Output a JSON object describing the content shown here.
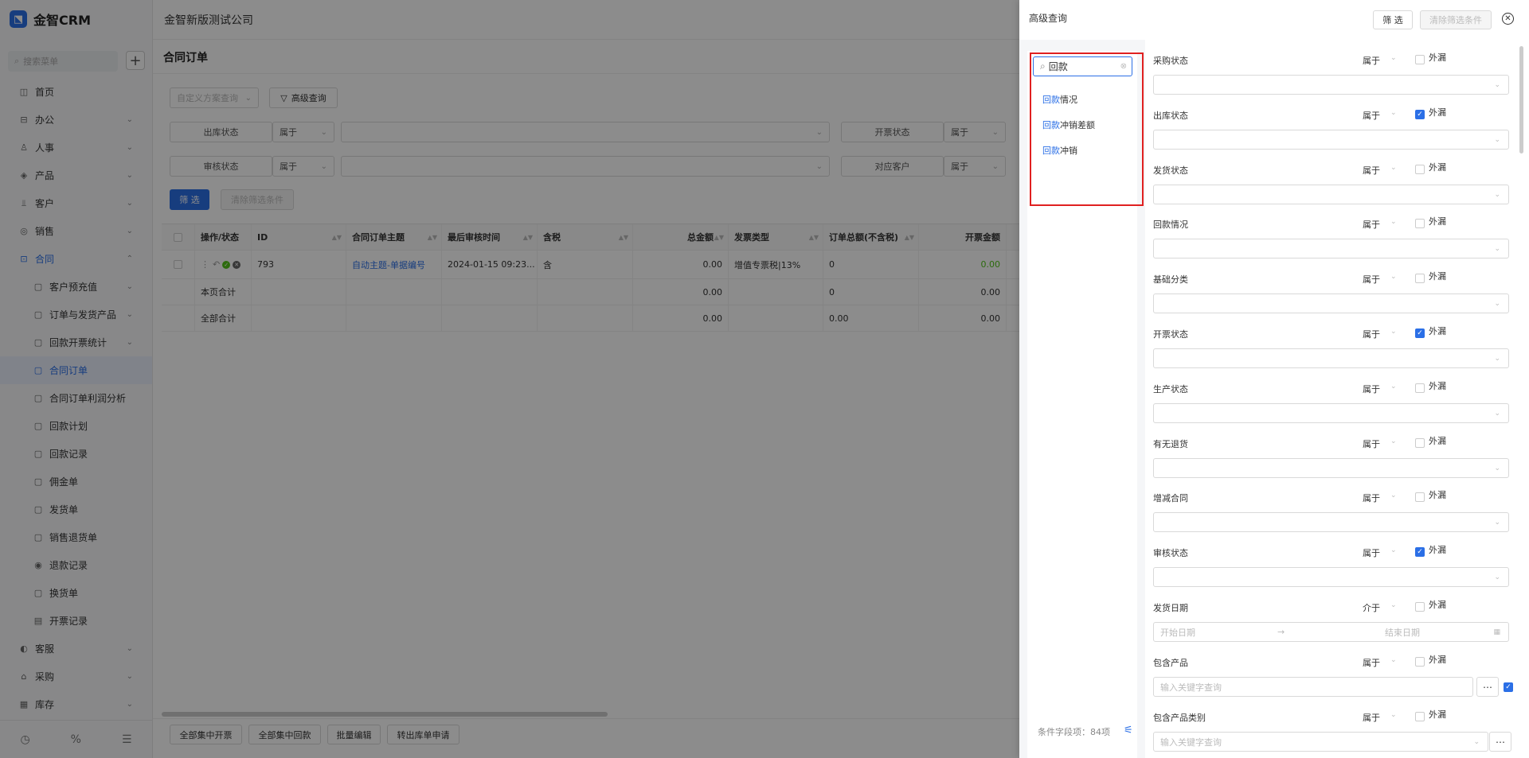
{
  "app": {
    "name": "金智CRM",
    "company": "金智新版测试公司"
  },
  "sidebar": {
    "search_placeholder": "搜索菜单",
    "items": [
      {
        "label": "首页",
        "icon": "home-icon"
      },
      {
        "label": "办公",
        "icon": "office-icon"
      },
      {
        "label": "人事",
        "icon": "people-icon"
      },
      {
        "label": "产品",
        "icon": "product-icon"
      },
      {
        "label": "客户",
        "icon": "customer-icon"
      },
      {
        "label": "销售",
        "icon": "sales-icon"
      },
      {
        "label": "合同",
        "icon": "contract-icon"
      },
      {
        "label": "客户预充值",
        "icon": "file-icon"
      },
      {
        "label": "订单与发货产品",
        "icon": "file-icon"
      },
      {
        "label": "回款开票统计",
        "icon": "file-icon"
      },
      {
        "label": "合同订单",
        "icon": "file-icon"
      },
      {
        "label": "合同订单利润分析",
        "icon": "file-icon"
      },
      {
        "label": "回款计划",
        "icon": "file-icon"
      },
      {
        "label": "回款记录",
        "icon": "file-icon"
      },
      {
        "label": "佣金单",
        "icon": "file-icon"
      },
      {
        "label": "发货单",
        "icon": "file-icon"
      },
      {
        "label": "销售退货单",
        "icon": "file-icon"
      },
      {
        "label": "退款记录",
        "icon": "file-icon"
      },
      {
        "label": "换货单",
        "icon": "file-icon"
      },
      {
        "label": "开票记录",
        "icon": "file-icon"
      },
      {
        "label": "客服",
        "icon": "service-icon"
      },
      {
        "label": "采购",
        "icon": "purchase-icon"
      },
      {
        "label": "库存",
        "icon": "stock-icon"
      }
    ]
  },
  "page": {
    "title": "合同订单",
    "scheme_placeholder": "自定义方案查询",
    "advanced_label": "高级查询",
    "filter_label": "筛 选",
    "clear_label": "清除筛选条件"
  },
  "filters": [
    {
      "label": "出库状态",
      "op": "属于"
    },
    {
      "label": "开票状态",
      "op": "属于"
    },
    {
      "label": "审核状态",
      "op": "属于"
    },
    {
      "label": "对应客户",
      "op": "属于"
    }
  ],
  "table": {
    "headers": [
      "操作/状态",
      "ID",
      "合同订单主题",
      "最后审核时间",
      "含税",
      "总金额",
      "发票类型",
      "订单总额(不含税)",
      "开票金额"
    ],
    "row": {
      "id": "793",
      "subject": "自动主题-单据编号",
      "time": "2024-01-15 09:23...",
      "tax": "含",
      "total": "0.00",
      "invoice_type": "增值专票税|13%",
      "total_ex": "0",
      "invoiced": "0.00"
    },
    "page_sum": {
      "label": "本页合计",
      "total": "0.00",
      "total_ex": "0",
      "invoiced": "0.00"
    },
    "all_sum": {
      "label": "全部合计",
      "total": "0.00",
      "total_ex": "0.00",
      "invoiced": "0.00"
    }
  },
  "bottom_buttons": [
    "全部集中开票",
    "全部集中回款",
    "批量编辑",
    "转出库单申请"
  ],
  "drawer": {
    "title": "高级查询",
    "filter_label": "筛 选",
    "clear_label": "清除筛选条件",
    "search_value": "回款",
    "results": [
      {
        "hl": "回款",
        "rest": "情况"
      },
      {
        "hl": "回款",
        "rest": "冲销差额"
      },
      {
        "hl": "回款",
        "rest": "冲销"
      }
    ],
    "count_text": "条件字段项：84项",
    "conditions": [
      {
        "label": "采购状态",
        "op": "属于",
        "checked": false,
        "ext": "外漏",
        "placeholder": ""
      },
      {
        "label": "出库状态",
        "op": "属于",
        "checked": true,
        "ext": "外漏",
        "placeholder": ""
      },
      {
        "label": "发货状态",
        "op": "属于",
        "checked": false,
        "ext": "外漏",
        "placeholder": ""
      },
      {
        "label": "回款情况",
        "op": "属于",
        "checked": false,
        "ext": "外漏",
        "placeholder": ""
      },
      {
        "label": "基础分类",
        "op": "属于",
        "checked": false,
        "ext": "外漏",
        "placeholder": ""
      },
      {
        "label": "开票状态",
        "op": "属于",
        "checked": true,
        "ext": "外漏",
        "placeholder": ""
      },
      {
        "label": "生产状态",
        "op": "属于",
        "checked": false,
        "ext": "外漏",
        "placeholder": ""
      },
      {
        "label": "有无退货",
        "op": "属于",
        "checked": false,
        "ext": "外漏",
        "placeholder": ""
      },
      {
        "label": "增减合同",
        "op": "属于",
        "checked": false,
        "ext": "外漏",
        "placeholder": ""
      },
      {
        "label": "审核状态",
        "op": "属于",
        "checked": true,
        "ext": "外漏",
        "placeholder": ""
      },
      {
        "label": "发货日期",
        "op": "介于",
        "checked": false,
        "ext": "外漏",
        "placeholder": ""
      },
      {
        "label": "包含产品",
        "op": "属于",
        "checked": false,
        "ext": "外漏",
        "placeholder": "输入关键字查询"
      },
      {
        "label": "包含产品类别",
        "op": "属于",
        "checked": false,
        "ext": "外漏",
        "placeholder": "输入关键字查询"
      }
    ],
    "date_start": "开始日期",
    "date_end": "结束日期"
  }
}
